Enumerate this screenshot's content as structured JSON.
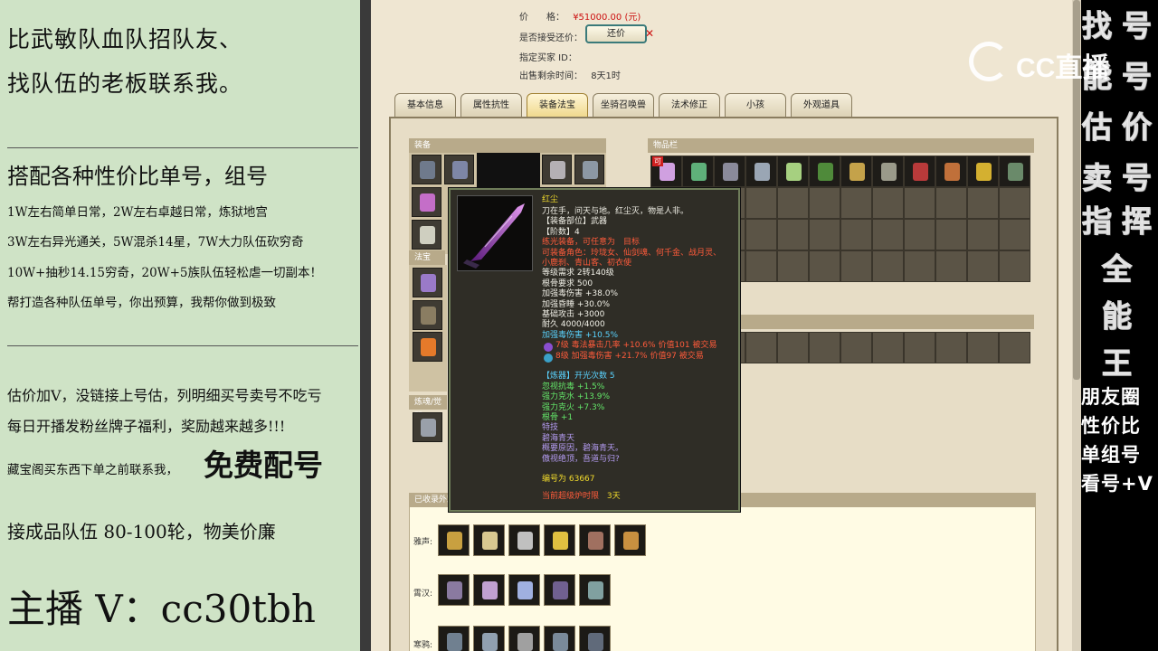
{
  "left_panel": {
    "lines": [
      "比武敏队血队招队友、",
      "找队伍的老板联系我。",
      "搭配各种性价比单号，组号",
      "1W左右简单日常，2W左右卓越日常，炼狱地宫",
      "3W左右异光通关，5W混杀14星，7W大力队伍砍穷奇",
      "10W+抽秒14.15穷奇，20W+5族队伍轻松虐一切副本！",
      "帮打造各种队伍单号，你出预算，我帮你做到极致",
      "估价加V，没链接上号估，列明细买号卖号不吃亏",
      "每日开播发粉丝牌子福利，奖励越来越多!!!",
      "藏宝阁买东西下单之前联系我，",
      "免费配号",
      "接成品队伍 80-100轮，物美价廉",
      "主播 V：cc30tbh"
    ]
  },
  "listing": {
    "price_label": "价　　格：",
    "price_value": "¥51000.00 (元)",
    "counter_label": "是否接受还价：",
    "counter_button": "还价",
    "counter_mark": "✕",
    "buyer_label": "指定买家 ID：",
    "time_label": "出售剩余时间：",
    "time_value": "8天1时"
  },
  "tabs": [
    "基本信息",
    "属性抗性",
    "装备法宝",
    "坐骑召唤兽",
    "法术修正",
    "小孩",
    "外观道具"
  ],
  "active_tab": "装备法宝",
  "sections": {
    "equip": "装备",
    "inventory": "物品栏",
    "treasure": "法宝",
    "fashion": "炼魂/觉醒",
    "owned": "已收录外观"
  },
  "inventory_badge": "可",
  "owned_rows": [
    "雅声:",
    "霄汉:",
    "寒鸦:"
  ],
  "tooltip": {
    "name": "红尘",
    "lines": [
      {
        "t": "刀在手，问天与地。红尘灭，物是人非。",
        "c": "c-white"
      },
      {
        "t": "【装备部位】武器",
        "c": "c-white"
      },
      {
        "t": "【阶数】4",
        "c": "c-white"
      },
      {
        "t": "练光装备，可任意为　目标",
        "c": "c-red"
      },
      {
        "t": "可装备角色：玲珑女、仙剑魂、何千金、战月灵、",
        "c": "c-red"
      },
      {
        "t": "小鹿刹、青山客、初衣使",
        "c": "c-red"
      },
      {
        "t": "等级需求 2转140级",
        "c": "c-white"
      },
      {
        "t": "根骨要求 500",
        "c": "c-white"
      },
      {
        "t": "加强毒伤害 +38.0%",
        "c": "c-white"
      },
      {
        "t": "加强昏睡 +30.0%",
        "c": "c-white"
      },
      {
        "t": "基础攻击 +3000",
        "c": "c-white"
      },
      {
        "t": "耐久 4000/4000",
        "c": "c-white"
      },
      {
        "t": "加强毒伤害 +10.5%",
        "c": "c-cyan"
      },
      {
        "t": "7级 毒法暴击几率 +10.6% 价值101 被交易",
        "c": "c-red"
      },
      {
        "t": "8级 加强毒伤害 +21.7% 价值97 被交易",
        "c": "c-red"
      },
      {
        "t": "",
        "c": "c-white"
      },
      {
        "t": "【炼器】开光次数 5",
        "c": "c-cyan"
      },
      {
        "t": "忽视抗毒 +1.5%",
        "c": "c-green"
      },
      {
        "t": "强力克水 +13.9%",
        "c": "c-green"
      },
      {
        "t": "强力克火 +7.3%",
        "c": "c-green"
      },
      {
        "t": "根骨 +1",
        "c": "c-green"
      },
      {
        "t": "特技",
        "c": "c-purple"
      },
      {
        "t": "碧海青天",
        "c": "c-purple"
      },
      {
        "t": "概要原因，碧海青天。",
        "c": "c-purple"
      },
      {
        "t": "傲视绝顶，吾道与归?",
        "c": "c-purple"
      },
      {
        "t": "",
        "c": "c-white"
      },
      {
        "t": "编号为 63667",
        "c": "c-yellow"
      }
    ],
    "footer_red": "当前超级炉时限",
    "footer_days": "3天"
  },
  "right_panel": {
    "chars": [
      "找",
      "号",
      "能",
      "号",
      "估",
      "价",
      "卖",
      "号",
      "指",
      "挥",
      "全",
      "能",
      "王"
    ],
    "lines": [
      "朋友圈",
      "性价比",
      "单组号",
      "看号+V"
    ]
  },
  "watermark": "CC直播"
}
